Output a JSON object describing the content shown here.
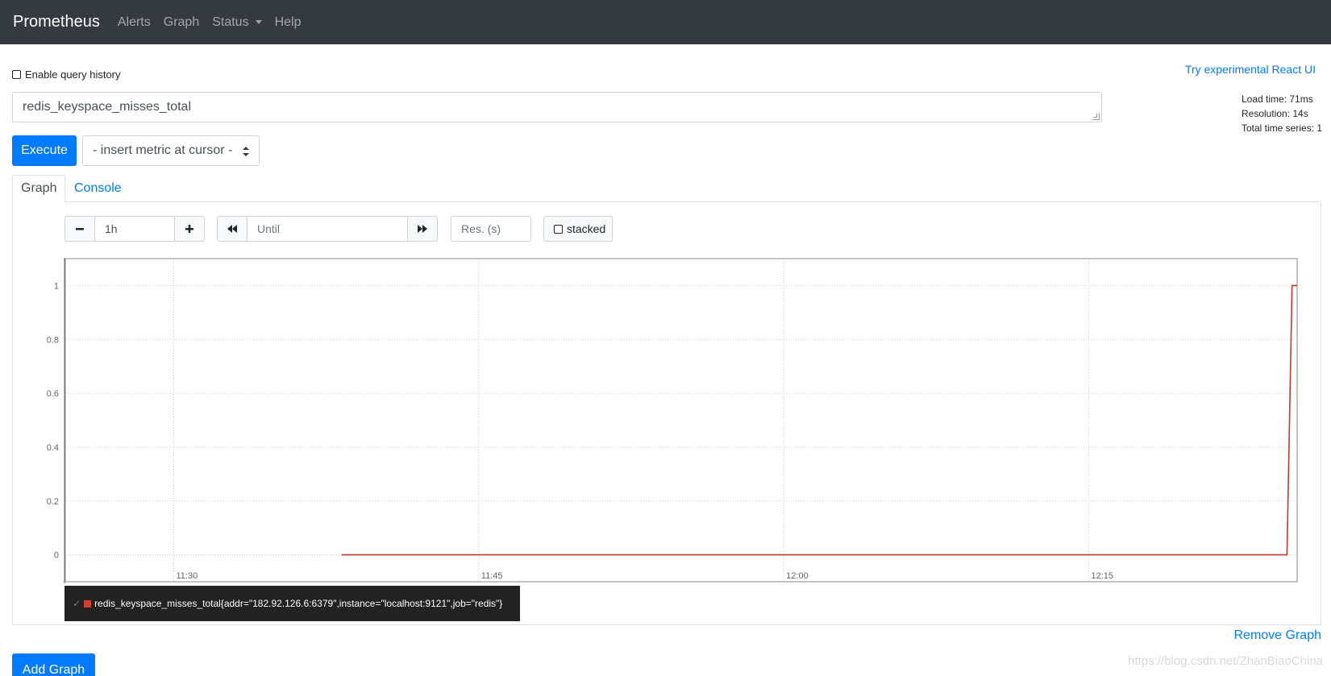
{
  "navbar": {
    "brand": "Prometheus",
    "items": [
      {
        "label": "Alerts"
      },
      {
        "label": "Graph"
      },
      {
        "label": "Status"
      },
      {
        "label": "Help"
      }
    ]
  },
  "query_history": {
    "label": "Enable query history",
    "checked": false
  },
  "react_link": "Try experimental React UI",
  "query": {
    "value": "redis_keyspace_misses_total"
  },
  "stats": {
    "load_time": "Load time: 71ms",
    "resolution": "Resolution: 14s",
    "total_series": "Total time series: 1"
  },
  "execute_label": "Execute",
  "metric_select": "- insert metric at cursor -",
  "tabs": [
    {
      "label": "Graph",
      "active": true
    },
    {
      "label": "Console",
      "active": false
    }
  ],
  "graph_controls": {
    "range": "1h",
    "until_placeholder": "Until",
    "res_placeholder": "Res. (s)",
    "stacked_label": "stacked",
    "stacked_checked": false
  },
  "chart_data": {
    "type": "line",
    "x_ticks": [
      "11:30",
      "11:45",
      "12:00",
      "12:15"
    ],
    "y_ticks": [
      "0",
      "0.2",
      "0.4",
      "0.6",
      "0.8",
      "1"
    ],
    "ylim": [
      -0.1,
      1.1
    ],
    "grid": true,
    "series": [
      {
        "name": "redis_keyspace_misses_total{addr=\"182.92.126.6:6379\",instance=\"localhost:9121\",job=\"redis\"}",
        "color": "#c0392b",
        "points": [
          {
            "x": "11:38:15",
            "y": 0
          },
          {
            "x": "12:24:45",
            "y": 0
          },
          {
            "x": "12:25:00",
            "y": 1
          },
          {
            "x": "12:25:15",
            "y": 1
          }
        ]
      }
    ]
  },
  "remove_graph": "Remove Graph",
  "add_graph": "Add Graph",
  "watermark": "https://blog.csdn.net/ZhanBiaoChina"
}
